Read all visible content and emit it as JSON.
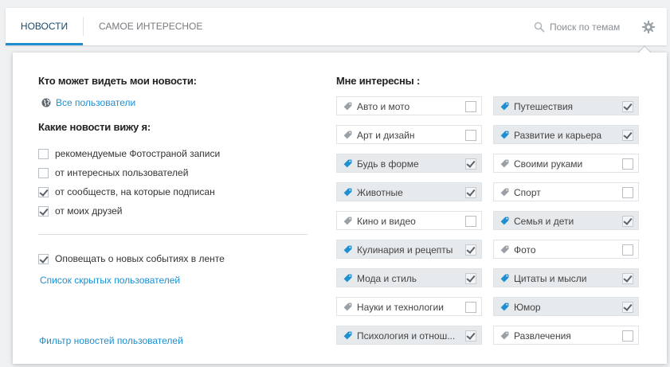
{
  "tabs": {
    "news": "Новости",
    "interesting": "Самое интересное"
  },
  "search": {
    "placeholder": "Поиск по темам"
  },
  "colors": {
    "accent": "#1e8fd0",
    "tag_selected": "#1e8fd0",
    "tag_unselected": "#9aa0a6",
    "selected_bg": "#e7eaed"
  },
  "privacy": {
    "heading": "Кто может видеть мои новости:",
    "link": "Все пользователи",
    "icon": "globe-icon"
  },
  "feed": {
    "heading": "Какие новости вижу я:",
    "options": [
      {
        "label": "рекомендуемые Фотостраной записи",
        "checked": false
      },
      {
        "label": "от интересных пользователей",
        "checked": false
      },
      {
        "label": "от сообществ, на которые подписан",
        "checked": true
      },
      {
        "label": "от моих друзей",
        "checked": true
      }
    ]
  },
  "notify": {
    "label": "Оповещать о новых событиях в ленте",
    "checked": true
  },
  "links": {
    "hidden_users": "Список скрытых пользователей",
    "filter": "Фильтр новостей пользователей"
  },
  "interests": {
    "heading": "Мне интересны :",
    "left": [
      {
        "label": "Авто и мото",
        "selected": false
      },
      {
        "label": "Арт и дизайн",
        "selected": false
      },
      {
        "label": "Будь в форме",
        "selected": true
      },
      {
        "label": "Животные",
        "selected": true
      },
      {
        "label": "Кино и видео",
        "selected": false
      },
      {
        "label": "Кулинария и рецепты",
        "selected": true
      },
      {
        "label": "Мода и стиль",
        "selected": true
      },
      {
        "label": "Науки и технологии",
        "selected": false
      },
      {
        "label": "Психология и отнош...",
        "selected": true
      }
    ],
    "right": [
      {
        "label": "Путешествия",
        "selected": true
      },
      {
        "label": "Развитие и карьера",
        "selected": true
      },
      {
        "label": "Своими руками",
        "selected": false
      },
      {
        "label": "Спорт",
        "selected": false
      },
      {
        "label": "Семья и дети",
        "selected": true
      },
      {
        "label": "Фото",
        "selected": false
      },
      {
        "label": "Цитаты и мысли",
        "selected": true
      },
      {
        "label": "Юмор",
        "selected": true
      },
      {
        "label": "Развлечения",
        "selected": false
      }
    ]
  }
}
